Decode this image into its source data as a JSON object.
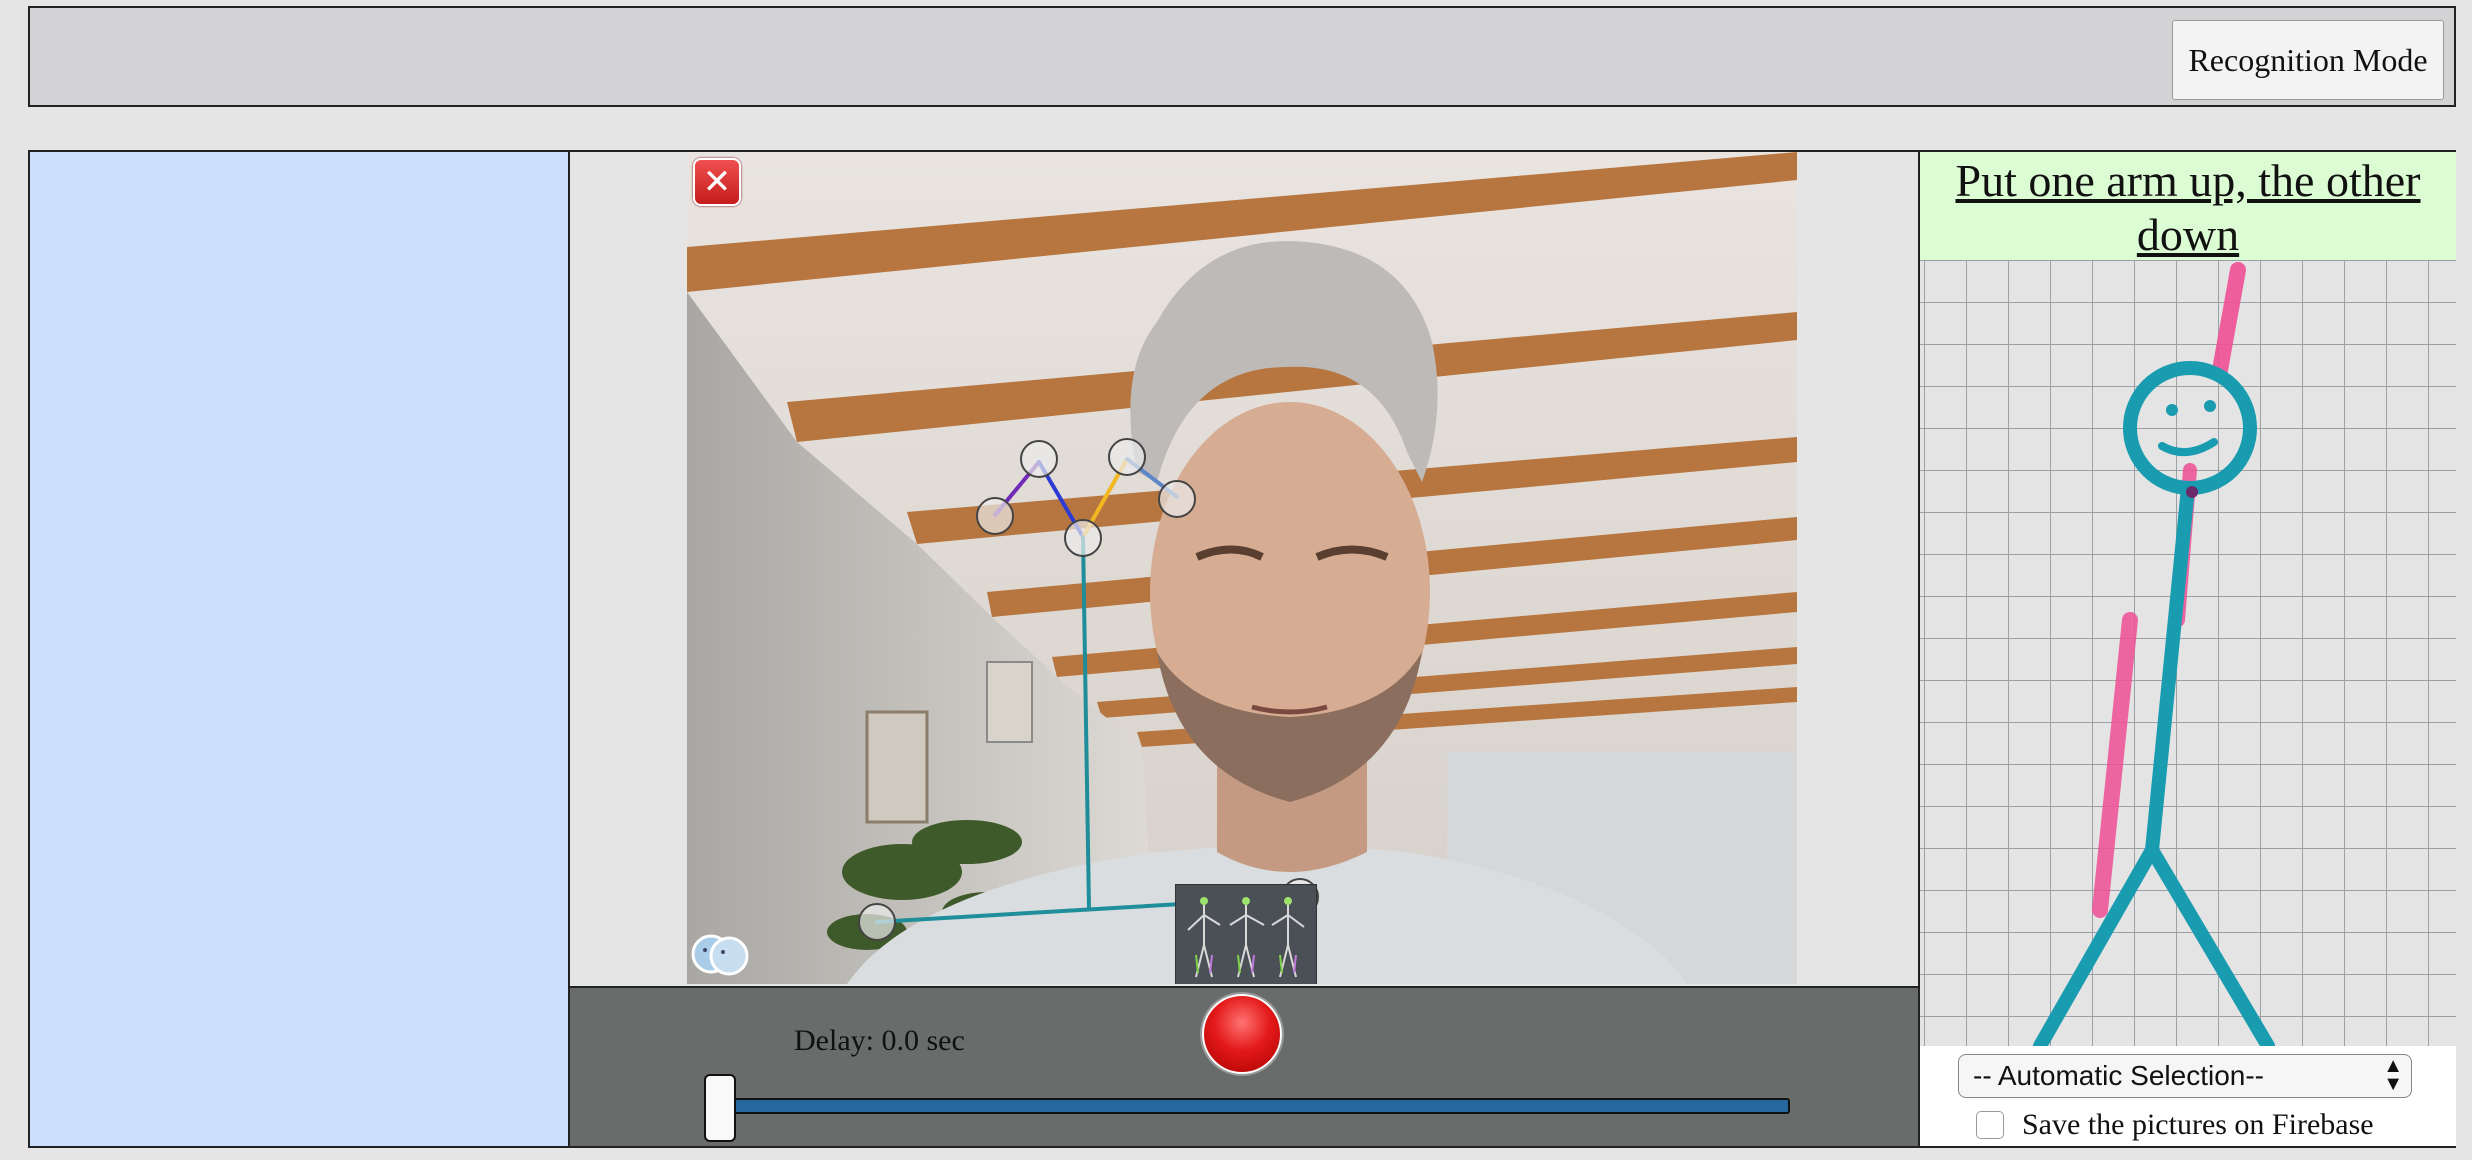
{
  "header": {
    "mode_button_label": "Recognition Mode"
  },
  "camera": {
    "close_icon": "close-icon",
    "pose_thumbnail_icon": "pose-thumbnail-icon",
    "corner_icon": "faces-icon"
  },
  "controls": {
    "delay_label": "Delay: 0.0 sec",
    "record_icon": "record-icon",
    "delay_slider_value": 0.0
  },
  "instruction_panel": {
    "instruction_text": "Put one arm up, the other down",
    "select_value": "-- Automatic Selection--",
    "save_checkbox_label": "Save the pictures on Firebase",
    "save_checked": false
  },
  "colors": {
    "left_panel": "#cce0fe",
    "instruction_bg": "#dcfcd4",
    "controls_bg": "#686c6a",
    "slider_track": "#27679f",
    "record_button": "#e41919"
  }
}
